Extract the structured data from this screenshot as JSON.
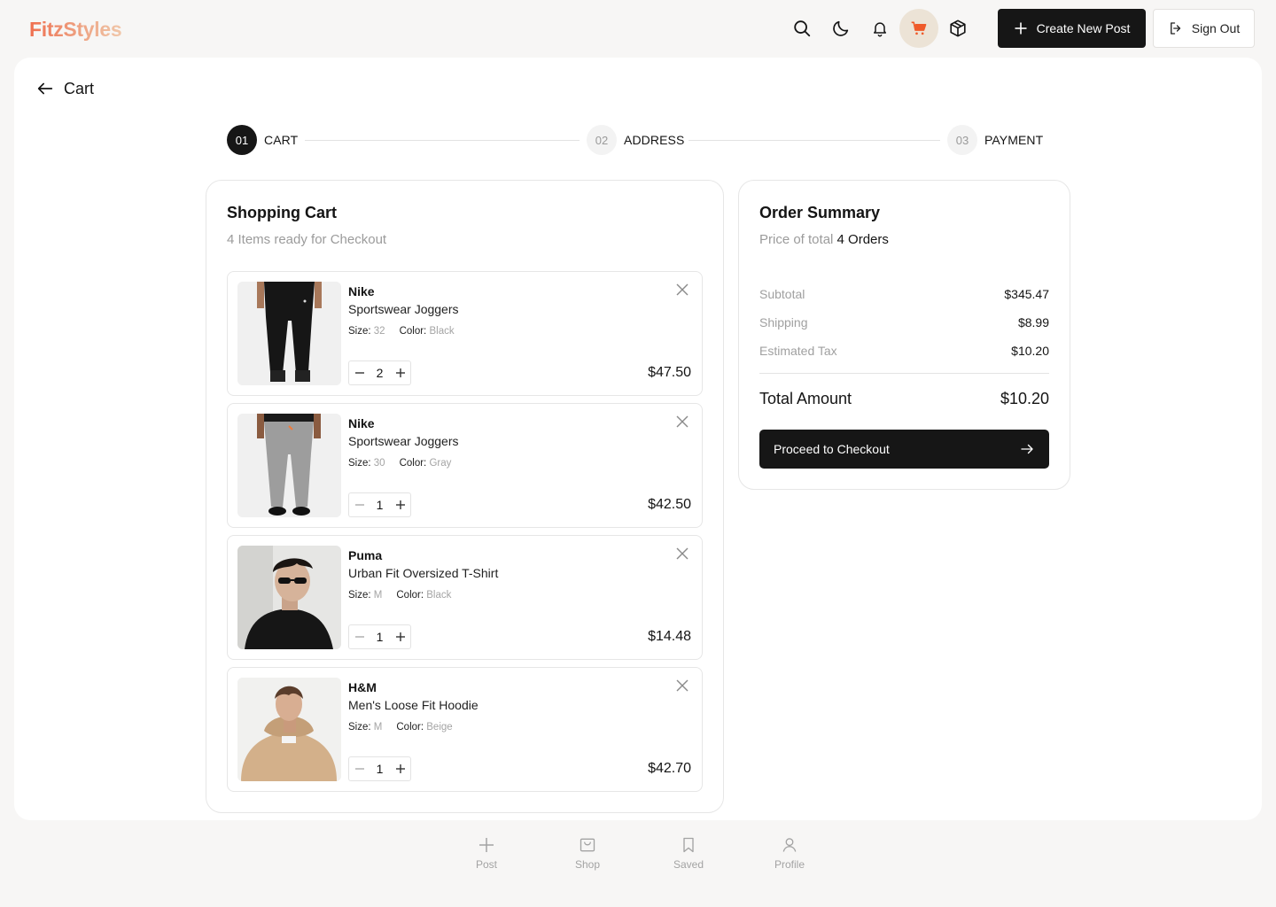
{
  "app": {
    "logo": "FitzStyles",
    "accent": "#ef6f4f"
  },
  "topbar": {
    "icons": [
      "search-icon",
      "moon-icon",
      "bell-icon",
      "cart-icon",
      "box-icon"
    ],
    "active_icon": "cart-icon",
    "create_label": "Create New Post",
    "signout_label": "Sign Out"
  },
  "page": {
    "title": "Cart"
  },
  "stepper": [
    {
      "num": "01",
      "label": "CART",
      "active": true
    },
    {
      "num": "02",
      "label": "ADDRESS",
      "active": false
    },
    {
      "num": "03",
      "label": "PAYMENT",
      "active": false
    }
  ],
  "cart": {
    "title": "Shopping Cart",
    "subtitle": "4 Items ready for Checkout",
    "size_key": "Size:",
    "color_key": "Color:",
    "items": [
      {
        "brand": "Nike",
        "name": "Sportswear Joggers",
        "size": "32",
        "color": "Black",
        "qty": "2",
        "price": "$47.50",
        "image": "black joggers"
      },
      {
        "brand": "Nike",
        "name": "Sportswear Joggers",
        "size": "30",
        "color": "Gray",
        "qty": "1",
        "price": "$42.50",
        "image": "gray joggers"
      },
      {
        "brand": "Puma",
        "name": "Urban Fit Oversized T-Shirt",
        "size": "M",
        "color": "Black",
        "qty": "1",
        "price": "$14.48",
        "image": "man in black t-shirt and sunglasses"
      },
      {
        "brand": "H&M",
        "name": "Men's Loose Fit Hoodie",
        "size": "M",
        "color": "Beige",
        "qty": "1",
        "price": "$42.70",
        "image": "man in beige hoodie"
      }
    ]
  },
  "summary": {
    "title": "Order Summary",
    "subtitle_prefix": "Price of total",
    "subtitle_count": "4 Orders",
    "rows": [
      {
        "label": "Subtotal",
        "value": "$345.47"
      },
      {
        "label": "Shipping",
        "value": "$8.99"
      },
      {
        "label": "Estimated Tax",
        "value": "$10.20"
      }
    ],
    "total_label": "Total Amount",
    "total_value": "$10.20",
    "checkout_label": "Proceed to Checkout"
  },
  "bottom_nav": [
    {
      "label": "Post",
      "icon": "plus-icon"
    },
    {
      "label": "Shop",
      "icon": "shop-icon"
    },
    {
      "label": "Saved",
      "icon": "bookmark-icon"
    },
    {
      "label": "Profile",
      "icon": "user-icon"
    }
  ]
}
